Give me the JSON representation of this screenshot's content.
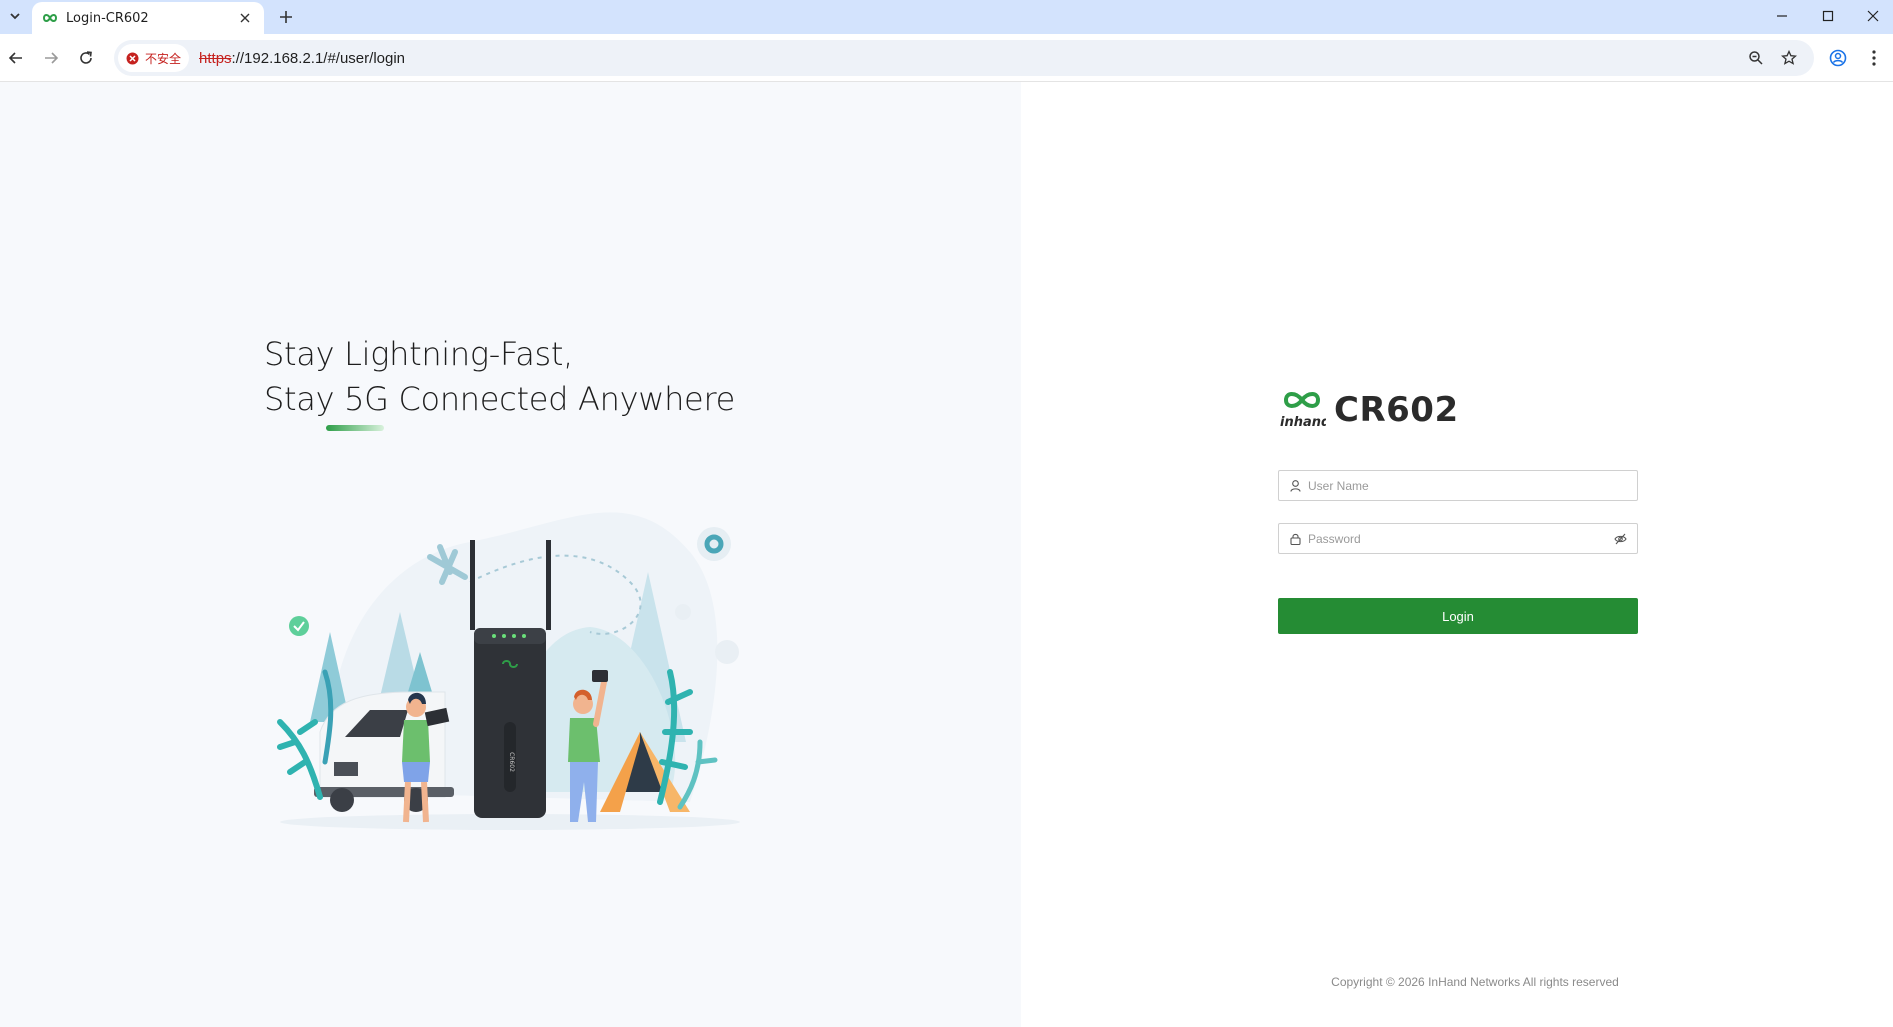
{
  "browser": {
    "tab": {
      "title": "Login-CR602"
    },
    "security_label": "不安全",
    "url_scheme": "https",
    "url_rest": "://192.168.2.1/#/user/login"
  },
  "hero": {
    "line1": "Stay Lightning-Fast,",
    "line2": "Stay 5G Connected Anywhere",
    "device_label": "CR602"
  },
  "login": {
    "brand_logo_text": "inhand",
    "product_name": "CR602",
    "username_placeholder": "User Name",
    "password_placeholder": "Password",
    "login_label": "Login"
  },
  "footer": {
    "copyright": "Copyright © 2026 InHand Networks All rights reserved"
  },
  "colors": {
    "primary": "#258c34",
    "tabstrip": "#d3e3fd",
    "insecure": "#c5221f"
  }
}
